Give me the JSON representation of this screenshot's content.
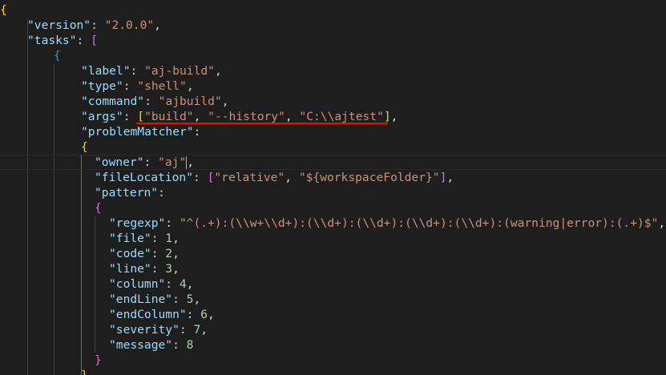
{
  "editor": {
    "lines": [
      {
        "tokens": [
          {
            "t": "{",
            "c": "b-gold"
          }
        ]
      },
      {
        "tokens": [
          {
            "t": "\"version\"",
            "c": "k"
          },
          {
            "t": ": ",
            "c": "p"
          },
          {
            "t": "\"2.0.0\"",
            "c": "s"
          },
          {
            "t": ",",
            "c": "p"
          }
        ]
      },
      {
        "tokens": [
          {
            "t": "\"tasks\"",
            "c": "k"
          },
          {
            "t": ": ",
            "c": "p"
          },
          {
            "t": "[",
            "c": "b-pink"
          }
        ]
      },
      {
        "tokens": [
          {
            "t": "{",
            "c": "b-blue"
          }
        ]
      },
      {
        "tokens": [
          {
            "t": "\"label\"",
            "c": "k"
          },
          {
            "t": ": ",
            "c": "p"
          },
          {
            "t": "\"aj-build\"",
            "c": "s"
          },
          {
            "t": ",",
            "c": "p"
          }
        ]
      },
      {
        "tokens": [
          {
            "t": "\"type\"",
            "c": "k"
          },
          {
            "t": ": ",
            "c": "p"
          },
          {
            "t": "\"shell\"",
            "c": "s"
          },
          {
            "t": ",",
            "c": "p"
          }
        ]
      },
      {
        "tokens": [
          {
            "t": "\"command\"",
            "c": "k"
          },
          {
            "t": ": ",
            "c": "p"
          },
          {
            "t": "\"ajbuild\"",
            "c": "s"
          },
          {
            "t": ",",
            "c": "p"
          }
        ]
      },
      {
        "tokens": [
          {
            "t": "\"args\"",
            "c": "k"
          },
          {
            "t": ": ",
            "c": "p"
          },
          {
            "t": "[",
            "c": "b-gold"
          },
          {
            "t": "\"build\"",
            "c": "s"
          },
          {
            "t": ", ",
            "c": "p"
          },
          {
            "t": "\"--history\"",
            "c": "s"
          },
          {
            "t": ", ",
            "c": "p"
          },
          {
            "t": "\"C:\\\\ajtest\"",
            "c": "s"
          },
          {
            "t": "]",
            "c": "b-gold"
          },
          {
            "t": ",",
            "c": "p"
          }
        ]
      },
      {
        "tokens": [
          {
            "t": "\"problemMatcher\"",
            "c": "k"
          },
          {
            "t": ":",
            "c": "p"
          }
        ]
      },
      {
        "tokens": [
          {
            "t": "{",
            "c": "b-gold"
          }
        ]
      },
      {
        "tokens": [
          {
            "t": "\"owner\"",
            "c": "k"
          },
          {
            "t": ": ",
            "c": "p"
          },
          {
            "t": "\"aj\"",
            "c": "s"
          },
          {
            "t": ",",
            "c": "p"
          }
        ]
      },
      {
        "tokens": [
          {
            "t": "\"fileLocation\"",
            "c": "k"
          },
          {
            "t": ": ",
            "c": "p"
          },
          {
            "t": "[",
            "c": "b-pink"
          },
          {
            "t": "\"relative\"",
            "c": "s"
          },
          {
            "t": ", ",
            "c": "p"
          },
          {
            "t": "\"${workspaceFolder}\"",
            "c": "s"
          },
          {
            "t": "]",
            "c": "b-pink"
          },
          {
            "t": ",",
            "c": "p"
          }
        ]
      },
      {
        "tokens": [
          {
            "t": "\"pattern\"",
            "c": "k"
          },
          {
            "t": ":",
            "c": "p"
          }
        ]
      },
      {
        "tokens": [
          {
            "t": "{",
            "c": "b-pink"
          }
        ]
      },
      {
        "tokens": [
          {
            "t": "\"regexp\"",
            "c": "k"
          },
          {
            "t": ": ",
            "c": "p"
          },
          {
            "t": "\"^(.+):(\\\\w+\\\\d+):(\\\\d+):(\\\\d+):(\\\\d+):(\\\\d+):(warning|error):(.+)$\"",
            "c": "s"
          },
          {
            "t": ",",
            "c": "p"
          }
        ]
      },
      {
        "tokens": [
          {
            "t": "\"file\"",
            "c": "k"
          },
          {
            "t": ": ",
            "c": "p"
          },
          {
            "t": "1",
            "c": "n"
          },
          {
            "t": ",",
            "c": "p"
          }
        ]
      },
      {
        "tokens": [
          {
            "t": "\"code\"",
            "c": "k"
          },
          {
            "t": ": ",
            "c": "p"
          },
          {
            "t": "2",
            "c": "n"
          },
          {
            "t": ",",
            "c": "p"
          }
        ]
      },
      {
        "tokens": [
          {
            "t": "\"line\"",
            "c": "k"
          },
          {
            "t": ": ",
            "c": "p"
          },
          {
            "t": "3",
            "c": "n"
          },
          {
            "t": ",",
            "c": "p"
          }
        ]
      },
      {
        "tokens": [
          {
            "t": "\"column\"",
            "c": "k"
          },
          {
            "t": ": ",
            "c": "p"
          },
          {
            "t": "4",
            "c": "n"
          },
          {
            "t": ",",
            "c": "p"
          }
        ]
      },
      {
        "tokens": [
          {
            "t": "\"endLine\"",
            "c": "k"
          },
          {
            "t": ": ",
            "c": "p"
          },
          {
            "t": "5",
            "c": "n"
          },
          {
            "t": ",",
            "c": "p"
          }
        ]
      },
      {
        "tokens": [
          {
            "t": "\"endColumn\"",
            "c": "k"
          },
          {
            "t": ": ",
            "c": "p"
          },
          {
            "t": "6",
            "c": "n"
          },
          {
            "t": ",",
            "c": "p"
          }
        ]
      },
      {
        "tokens": [
          {
            "t": "\"severity\"",
            "c": "k"
          },
          {
            "t": ": ",
            "c": "p"
          },
          {
            "t": "7",
            "c": "n"
          },
          {
            "t": ",",
            "c": "p"
          }
        ]
      },
      {
        "tokens": [
          {
            "t": "\"message\"",
            "c": "k"
          },
          {
            "t": ": ",
            "c": "p"
          },
          {
            "t": "8",
            "c": "n"
          }
        ]
      },
      {
        "tokens": [
          {
            "t": "}",
            "c": "b-pink"
          }
        ]
      },
      {
        "tokens": [
          {
            "t": "}",
            "c": "b-gold"
          }
        ]
      }
    ]
  }
}
